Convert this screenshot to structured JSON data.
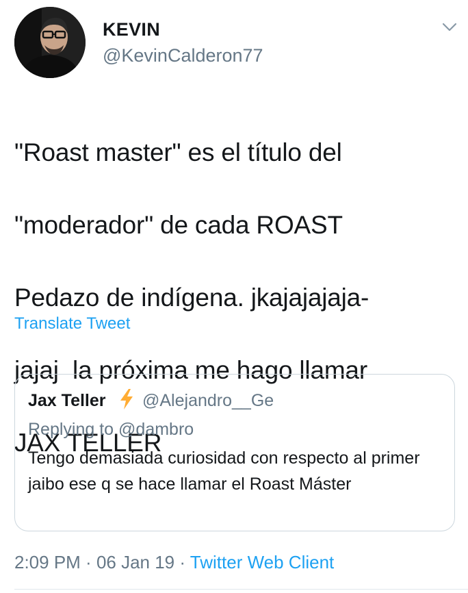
{
  "author": {
    "display_name": "KEVIN",
    "handle": "@KevinCalderon77",
    "avatar_icon": "user-avatar-photo"
  },
  "menu": {
    "icon": "chevron-down-icon"
  },
  "tweet": {
    "text": "\"Roast master\" es el título del \"moderador\" de cada ROAST Pedazo de indígena. jkajajajaja-jajaj  la próxima me hago llamar JAX TELLER",
    "lines": [
      "\"Roast master\" es el título del",
      "\"moderador\" de cada ROAST",
      "Pedazo de indígena. jkajajajaja-",
      "jajaj  la próxima me hago llamar",
      "JAX TELLER"
    ],
    "translate_label": "Translate Tweet"
  },
  "quoted_tweet": {
    "display_name": "Jax Teller",
    "badge_icon": "lightning-bolt-icon",
    "handle": "@Alejandro__Ge",
    "replying_prefix": "Replying to ",
    "replying_to": "@dambro",
    "text": "Tengo demasiada curiosidad con respecto al primer jaibo ese q se hace llamar el Roast Máster"
  },
  "meta": {
    "time": "2:09 PM",
    "separator": " · ",
    "date": "06 Jan 19",
    "client": "Twitter Web Client"
  },
  "colors": {
    "link": "#1da1f2",
    "secondary_text": "#657786",
    "primary_text": "#14171a",
    "border": "#ccd6dd",
    "bolt": "#ffac33"
  }
}
